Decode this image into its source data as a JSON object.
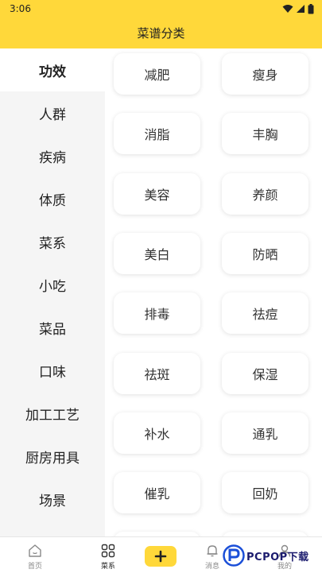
{
  "status": {
    "time": "3:06"
  },
  "header": {
    "title": "菜谱分类"
  },
  "sidebar": {
    "items": [
      {
        "label": "功效"
      },
      {
        "label": "人群"
      },
      {
        "label": "疾病"
      },
      {
        "label": "体质"
      },
      {
        "label": "菜系"
      },
      {
        "label": "小吃"
      },
      {
        "label": "菜品"
      },
      {
        "label": "口味"
      },
      {
        "label": "加工工艺"
      },
      {
        "label": "厨房用具"
      },
      {
        "label": "场景"
      }
    ],
    "active_index": 0
  },
  "tags": [
    {
      "label": "减肥"
    },
    {
      "label": "瘦身"
    },
    {
      "label": "消脂"
    },
    {
      "label": "丰胸"
    },
    {
      "label": "美容"
    },
    {
      "label": "养颜"
    },
    {
      "label": "美白"
    },
    {
      "label": "防晒"
    },
    {
      "label": "排毒"
    },
    {
      "label": "祛痘"
    },
    {
      "label": "祛斑"
    },
    {
      "label": "保湿"
    },
    {
      "label": "补水"
    },
    {
      "label": "通乳"
    },
    {
      "label": "催乳"
    },
    {
      "label": "回奶"
    }
  ],
  "tabbar": {
    "items": [
      {
        "label": "首页",
        "icon": "home-icon"
      },
      {
        "label": "菜系",
        "icon": "grid-icon"
      },
      {
        "label": "消息",
        "icon": "bell-icon"
      },
      {
        "label": "我的",
        "icon": "user-icon"
      }
    ],
    "add_icon": "plus-icon",
    "active_index": 1
  },
  "watermark": {
    "text": "PCPOP下载"
  },
  "colors": {
    "accent": "#FFD83A",
    "sidebar_bg": "#f5f5f5",
    "text": "#222222"
  }
}
